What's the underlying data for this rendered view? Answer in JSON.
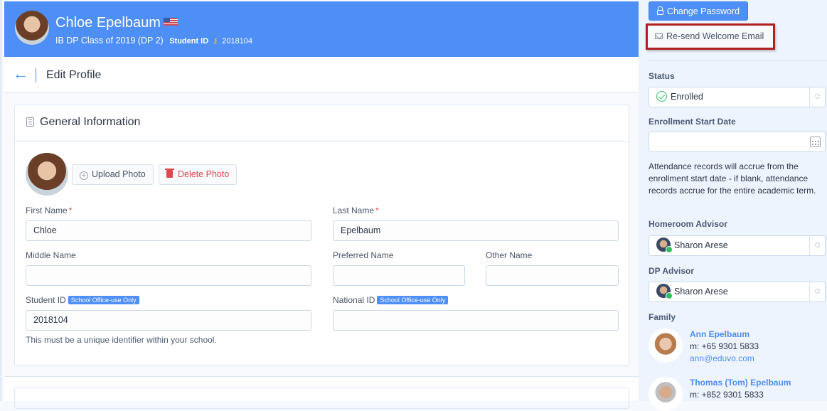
{
  "header": {
    "student_name": "Chloe Epelbaum",
    "flag": "us-flag",
    "class_info": "IB DP Class of 2019 (DP 2)",
    "student_id_label": "Student ID",
    "student_id": "2018104"
  },
  "topbar": {
    "back_icon": "←",
    "title": "Edit Profile"
  },
  "general": {
    "title": "General Information",
    "upload_label": "Upload Photo",
    "delete_label": "Delete Photo",
    "upload_icon": "+",
    "fields": {
      "first_name": {
        "label": "First Name",
        "required": "*",
        "value": "Chloe"
      },
      "last_name": {
        "label": "Last Name",
        "required": "*",
        "value": "Epelbaum"
      },
      "middle_name": {
        "label": "Middle Name",
        "value": ""
      },
      "preferred_name": {
        "label": "Preferred Name",
        "value": ""
      },
      "other_name": {
        "label": "Other Name",
        "value": ""
      },
      "student_id": {
        "label": "Student ID",
        "badge": "School Office-use Only",
        "value": "2018104",
        "help": "This must be a unique identifier within your school."
      },
      "national_id": {
        "label": "National ID",
        "badge": "School Office-use Only",
        "value": ""
      }
    }
  },
  "sidebar": {
    "change_password_label": "Change Password",
    "resend_label": "Re-send Welcome Email",
    "status": {
      "label": "Status",
      "value": "Enrolled"
    },
    "enrollment": {
      "label": "Enrollment Start Date",
      "value": "",
      "note": "Attendance records will accrue from the enrollment start date - if blank, attendance records accrue for the entire academic term."
    },
    "homeroom": {
      "label": "Homeroom Advisor",
      "value": "Sharon Arese"
    },
    "dp_advisor": {
      "label": "DP Advisor",
      "value": "Sharon Arese"
    },
    "family": {
      "label": "Family",
      "members": [
        {
          "name": "Ann Epelbaum",
          "mobile": "m: +65 9301 5833",
          "email": "ann@eduvo.com"
        },
        {
          "name": "Thomas (Tom) Epelbaum",
          "mobile": "m: +852 9301 5833"
        }
      ]
    },
    "colors": {
      "accent": "#4d8ef7",
      "success": "#3bbf6c",
      "danger": "#e0484f",
      "highlight": "#b21f1f"
    }
  }
}
